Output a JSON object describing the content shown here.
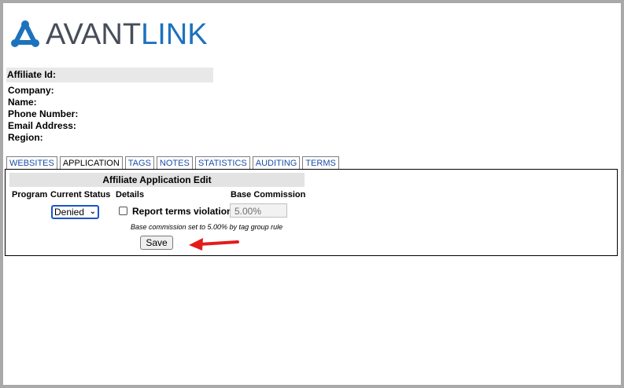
{
  "logo": {
    "text_part1": "AVANT",
    "text_part2": "LINK",
    "colors": {
      "dark": "#474d59",
      "blue": "#1d72bd"
    }
  },
  "affiliate": {
    "id_label": "Affiliate Id:",
    "fields": [
      "Company:",
      "Name:",
      "Phone Number:",
      "Email Address:",
      "Region:"
    ]
  },
  "tabs": [
    {
      "label": "WEBSITES",
      "active": false
    },
    {
      "label": "APPLICATION",
      "active": true
    },
    {
      "label": "TAGS",
      "active": false
    },
    {
      "label": "NOTES",
      "active": false
    },
    {
      "label": "STATISTICS",
      "active": false
    },
    {
      "label": "AUDITING",
      "active": false
    },
    {
      "label": "TERMS",
      "active": false
    }
  ],
  "form": {
    "title": "Affiliate Application Edit",
    "columns": {
      "program": "Program",
      "status": "Current Status",
      "details": "Details",
      "base": "Base Commission"
    },
    "status_value": "Denied",
    "checkbox_label": "Report terms violation",
    "checkbox_checked": false,
    "base_commission_value": "5.00%",
    "note": "Base commission set to 5.00% by tag group rule",
    "save_label": "Save"
  },
  "annotation": {
    "arrow_color": "#e31b1b",
    "arrow_icon": "red-arrow-left-icon"
  }
}
